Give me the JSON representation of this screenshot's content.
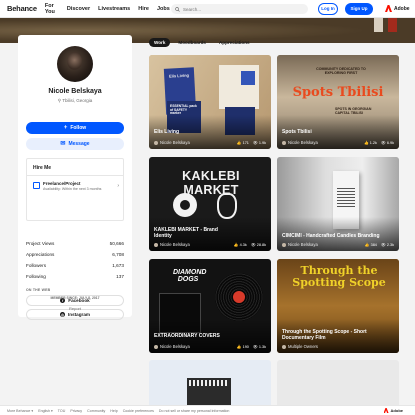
{
  "nav": {
    "logo": "Behance",
    "links": [
      "For You",
      "Discover",
      "Livestreams",
      "Hire",
      "Jobs"
    ],
    "search_placeholder": "Search...",
    "login": "Log In",
    "signup": "Sign Up",
    "adobe": "Adobe"
  },
  "profile": {
    "name": "Nicole Belskaya",
    "location": "Tbilisi, Georgia",
    "follow": "Follow",
    "message": "Message",
    "hire_title": "Hire Me",
    "hire_item_title": "Freelance/Project",
    "hire_item_sub": "Availability: Within the next 3 months",
    "stats": [
      {
        "label": "Project Views",
        "value": "50,666"
      },
      {
        "label": "Appreciations",
        "value": "6,708"
      },
      {
        "label": "Followers",
        "value": "1,673"
      },
      {
        "label": "Following",
        "value": "137"
      }
    ],
    "on_the_web": "ON THE WEB",
    "facebook": "Facebook",
    "instagram": "Instagram",
    "member_since": "MEMBER SINCE: JULY 8, 2017",
    "report": "Report"
  },
  "tabs": [
    "Work",
    "Moodboards",
    "Appreciations"
  ],
  "projects": [
    {
      "title": "Elis Living",
      "owner": "Nicole Belskaya",
      "likes": "171",
      "views": "1.9k"
    },
    {
      "title": "Spots Tbilisi",
      "owner": "Nicole Belskaya",
      "likes": "1.2k",
      "views": "6.9k"
    },
    {
      "title": "KAKLEBI MARKET - Brand Identity",
      "owner": "Nicole Belskaya",
      "likes": "4.3k",
      "views": "28.8k"
    },
    {
      "title": "CIMCIMI - Handcrafted Candles Branding",
      "owner": "Nicole Belskaya",
      "likes": "384",
      "views": "2.3k"
    },
    {
      "title": "EXTRAORDINARY COVERS",
      "owner": "Nicole Belskaya",
      "likes": "190",
      "views": "1.3k"
    },
    {
      "title": "Through the Spotting Scope - Short Documentary Film",
      "owner": "Multiple Owners",
      "likes": "",
      "views": ""
    }
  ],
  "art": {
    "c1_book_a": "Elis Living",
    "c1_book_b": "ESSENTIAL pack of SAFETY marker",
    "c2_top": "COMMUNITY DEDICATED TO EXPLORING FIRST",
    "c2_big": "Spots Tbilisi",
    "c2_sub": "SPOTS IN GEORGIAN CAPITAL TBILISI",
    "c3_big": "KAKLEBI MARKET",
    "c5_big": "DIAMOND DOGS",
    "c6_big": "Through the Spotting Scope"
  },
  "footer": {
    "links": [
      "More Behance ▾",
      "English ▾",
      "TOU",
      "Privacy",
      "Community",
      "Help",
      "Cookie preferences",
      "Do not sell or share my personal information"
    ],
    "adobe": "Adobe"
  }
}
